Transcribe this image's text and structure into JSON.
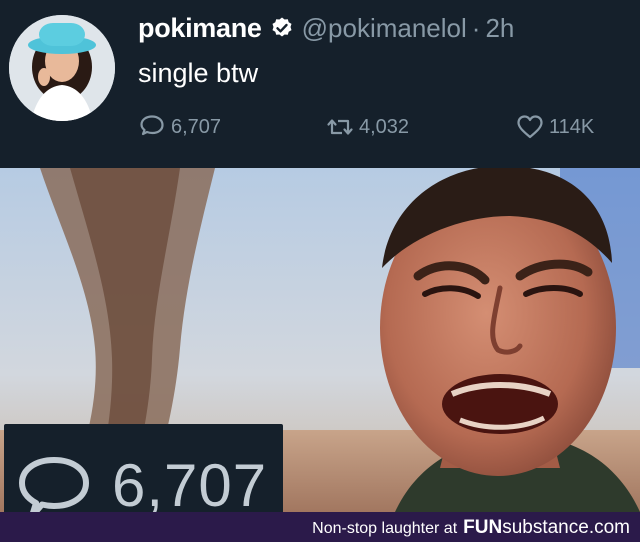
{
  "tweet": {
    "display_name": "pokimane",
    "verified_icon": "verified-badge-icon",
    "handle": "@pokimanelol",
    "separator": "·",
    "time": "2h",
    "text": "single btw",
    "actions": {
      "reply": {
        "icon": "reply-bubble-icon",
        "count": "6,707"
      },
      "retweet": {
        "icon": "retweet-icon",
        "count": "4,032"
      },
      "like": {
        "icon": "heart-icon",
        "count": "114K"
      }
    }
  },
  "meme": {
    "zoom_icon": "reply-bubble-icon",
    "zoom_count": "6,707"
  },
  "footer": {
    "text": "Non-stop laughter at",
    "brand_prefix": "FUN",
    "brand_suffix": "substance.com"
  },
  "colors": {
    "background": "#15202b",
    "secondary_text": "#8899a6",
    "footer_bg": "#2b1a4a"
  }
}
